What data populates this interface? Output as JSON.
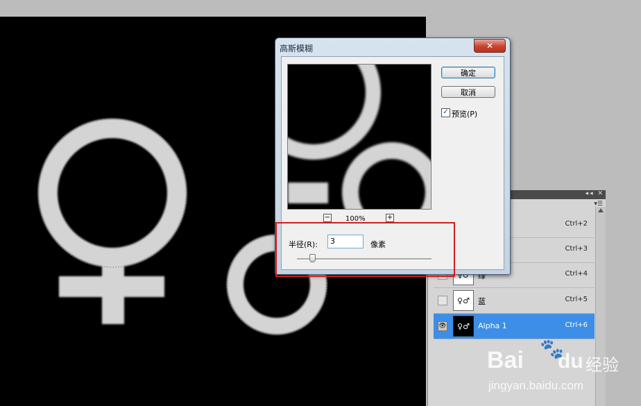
{
  "dialog": {
    "title": "高斯模糊",
    "close": "✕",
    "ok": "确定",
    "cancel": "取消",
    "preview_checked": "✓",
    "preview_label": "预览(P)",
    "zoom_out": "−",
    "zoom_in": "+",
    "zoom": "100%",
    "radius_label": "半径(R):",
    "radius_value": "3",
    "radius_unit": "像素"
  },
  "channels": {
    "panel_buttons": "◂◂ ✕",
    "menu_icon": "▾☰",
    "rows": [
      {
        "name": "",
        "shortcut": "Ctrl+2",
        "thumb": ""
      },
      {
        "name": "",
        "shortcut": "Ctrl+3",
        "thumb": ""
      },
      {
        "name": "绿",
        "shortcut": "Ctrl+4",
        "thumb": "♀♂"
      },
      {
        "name": "蓝",
        "shortcut": "Ctrl+5",
        "thumb": "♀♂"
      },
      {
        "name": "Alpha 1",
        "shortcut": "Ctrl+6",
        "thumb": "♀♂",
        "visible_icon": "👁"
      }
    ]
  },
  "watermark": {
    "brand": "Bai",
    "brand2": "du",
    "cn": "经验",
    "url": "jingyan.baidu.com"
  },
  "colors": {
    "accent_selected_row": "#3d8ee6",
    "highlight_box": "#d21c1c",
    "canvas": "#000000",
    "shape_fill": "#d4d4d4"
  }
}
